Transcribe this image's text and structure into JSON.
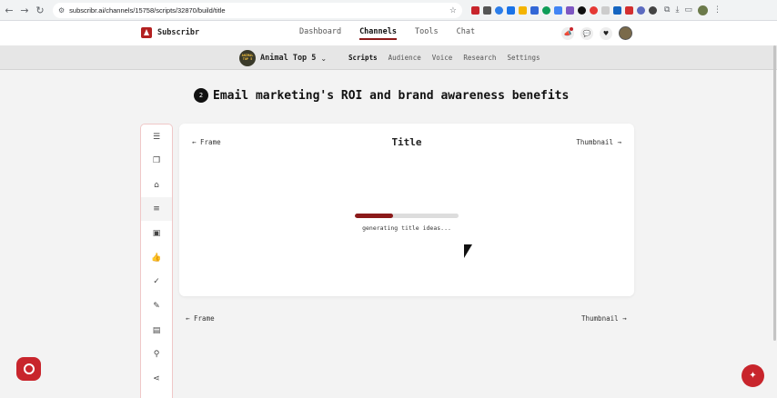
{
  "browser": {
    "url": "subscribr.ai/channels/15758/scripts/32870/build/title",
    "back_icon": "arrow-left-icon",
    "forward_icon": "arrow-right-icon",
    "reload_icon": "reload-icon"
  },
  "app": {
    "name": "Subscribr",
    "nav": [
      {
        "label": "Dashboard"
      },
      {
        "label": "Channels",
        "active": true
      },
      {
        "label": "Tools"
      },
      {
        "label": "Chat"
      }
    ],
    "accent_color": "#8b1a1a",
    "brand_red": "#c8252c"
  },
  "channel": {
    "name": "Animal Top 5",
    "thumb_text": "ANIMAL TOP 5",
    "tabs": [
      {
        "label": "Scripts",
        "active": true
      },
      {
        "label": "Audience"
      },
      {
        "label": "Voice"
      },
      {
        "label": "Research"
      },
      {
        "label": "Settings"
      }
    ]
  },
  "script": {
    "step": "2",
    "title": "Email marketing's ROI and brand awareness benefits"
  },
  "toolbar": {
    "tools": [
      {
        "icon": "sliders-icon",
        "glyph": "☰"
      },
      {
        "icon": "book-icon",
        "glyph": "❒"
      },
      {
        "icon": "map-icon",
        "glyph": "⌂"
      },
      {
        "icon": "list-icon",
        "glyph": "≡",
        "active": true
      },
      {
        "icon": "image-icon",
        "glyph": "▣"
      },
      {
        "icon": "thumbs-up-icon",
        "glyph": "👍"
      },
      {
        "icon": "check-circle-icon",
        "glyph": "✓"
      },
      {
        "icon": "pen-icon",
        "glyph": "✎"
      },
      {
        "icon": "document-icon",
        "glyph": "▤"
      },
      {
        "icon": "search-icon",
        "glyph": "⚲"
      },
      {
        "icon": "share-icon",
        "glyph": "⋖"
      }
    ]
  },
  "builder": {
    "prev_label": "← Frame",
    "heading": "Title",
    "next_label": "Thumbnail →",
    "progress": 0.37,
    "status": "generating title ideas...",
    "bottom_prev_label": "← Frame",
    "bottom_next_label": "Thumbnail →"
  },
  "widgets": {
    "help_icon": "chat-help-icon",
    "ai_icon": "sparkle-icon"
  }
}
